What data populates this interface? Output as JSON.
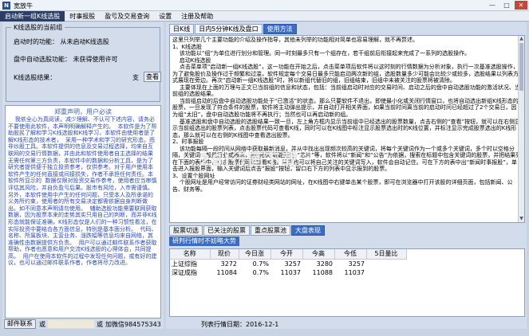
{
  "window": {
    "title": "宽放牛",
    "icon_letter": "N",
    "btn_min": "—",
    "btn_max": "□",
    "btn_close": "✕"
  },
  "menu": [
    "启动新一组K线选股",
    "时事报股",
    "盈亏及交易查询",
    "设置",
    "注册及帮助"
  ],
  "left": {
    "group_title": "K线选股的当前组",
    "line1": "启动时的功能：  从未启动K线选股",
    "line2": "盘中自动选股功能：  未获得使用许可",
    "line3": "K线选股结果：",
    "line3_tail": "支",
    "go_button": "查看",
    "notice_title": "郑重声明，用户必读",
    "notice_body": "    我依全心为真阅读，减少理解、不认可下述内容，请务必不要使用此软件，本声明明确解释产生的。  本软件是为了帮助股民了解和学习K线选股和K线学习，本软件由使用者是了解K线形态的技术者，  采用一种学术和学习的研究形态，而非炒股工具。本软件提供的信息及交易过程选择，均来自互联网的交易行情数据，并由此和软件使用者自主选择的结果无需任何第三方负责，本软件中的数据和分析工具，是为了研究者提供便于独立投资参考，仅供参考。对于用户使用本软件产生的任何直接或间接损失，作者不承担任何责任。本软件所显示的  数据仅限对投资交易作参考，使用者应当审慎评估其风险，并自负盈亏后果。股市有风险，入市需谨慎。  另外，本软件使用中产生的任何问题，只受本人及所承诺的义务所约束，使用者的所有交易决定都需依据自身判断做出。如不同意本声明请勿使用。  辅助选股功能需要联网获取数据，因为股票本来的走势其实只用自己的判断，而并非K线形态就能保证准确，K线形态仅是人们的一种习惯性看法，在实际投资中要结合各方面信息，特别是基本面分析。  代码、名称、所属板块、主营业务、涨跌幅等信息均来自网络，其准确性由数据提供方负责。  用户可以通过邮件联系作者获取帮助，作者也愿意和用户交流K线选股的心得体会，共同提高。  用户在使用本软件的过程中发现任何问题，或有好的建议，也可以通过邮件联系作者，作者将尽力改进。"
  },
  "left_status": {
    "mail_button": "邮件联系",
    "or1": "或",
    "or2": "或",
    "wechat": "加微信984575343"
  },
  "right": {
    "tabs": [
      {
        "label": "日K线",
        "selected": false
      },
      {
        "label": "日内5分钟K线及盘口",
        "selected": false
      },
      {
        "label": "使用方法",
        "selected": true
      }
    ],
    "doc_text": "这里只列举几个主要功能的介绍及操作指导，其他未列举的功能相对简单也容易理解，就不再赘述。\n1、K线选股\n    该功能以“组”为单位进行划分和管理。同一时刻最多只有一个组存在，若干组前后衔接起来完成了一系列的选股操作。\n    启动K线选股\n    点击菜单项“启动新一组K线选股”，这一功能在开始之后，点击菜单项后软件将以这时刻的行情数据为分析对象，执行一次基准选股操作，为了避免股价及操作过于频繁和过滥，软件规定每个交易日最多只能启动两次新的组，选股数量多少可能会比较少或较多，选股结果以列表方式展现在旁边。再次“启动新一组K线选股”时，将以新组代替旧的组，旧组结束，旧组中未被关注的股票将被清除。\n    主要体现在上面的万理与正文已当前组的信息和状态，包括：当前组启动时对应的交易时间、启动之后的盘中自动选股功能的激活状况、当前组的选股结果。\n    当前组启动的后盘中自动选股功能处于“已激活”的状态，那么只要软件不退出，即使最小化或关闭行情窗口，也将自动选出新组K线形态的股票，一旦发现了符合条件的股票，软件将主动弹出提示，并自动打开相关界面，如果当前时间离当前的启动时间已经超过了2个交易日，因为组“太旧”，盘中自动选股功能将不再执行；当然也可以再启动新的组。\n    基准选股和盘中自动选股的选股结果一致一旦，左上角方框内显示当前组中已经选出的股票数量，点击右侧的“查看”按钮，就可以在右侧显示当前组选出的股票列表，点击股票代码可查看K线，同时可以在K线图中标注显示股票选出时的K线位置，并标注显示完成股票选出的K线形态，那么就可以在右侧的K线图中查看选出股票。\n2、时事报股\n    该功能每隔一段时间从网络中获取最新消息，并从中找出出现频次较高的关键词，将每个关键词作为一个或多个关键词，多个时以空格分隔，关键词一般是行业或概念，如“光伏 新能源”、“芯片”等，软件将以“新闻”和“公告”为依据，搜索在标题中包含关键词的股票，并把结果列在下面的表格中，点击股票代码可查看K线。用户也可以将自己关注的关键词写入，软件会自动记住。可在下方的表中出“新闻时事报股”，单击进入报股界面，输入关键词后点击“报股”按钮，留口右下方的列表中显示报到的股票。\n3、设置个股网址\n    个股网址是用户经常访问的证券财经类网站的网址，在K线图中右键单击某个股票，即可在浏览器中打开该股的详细页面，包括新闻、公告、财务等。"
  },
  "lower": {
    "tabs": [
      {
        "label": "股票切选",
        "selected": false
      },
      {
        "label": "已关注的股票",
        "selected": false
      },
      {
        "label": "重点股票池",
        "selected": false
      },
      {
        "label": "大盘表现",
        "selected": true
      }
    ],
    "sub_header": "研判行情时不妨略大势",
    "columns": [
      "名称",
      "现价",
      "今日涨",
      "今开",
      "今高",
      "今低",
      "5日量比"
    ],
    "rows": [
      [
        "上证综指",
        "3272",
        "0.7%",
        "3257",
        "3280",
        "3257",
        ""
      ],
      [
        "深证成指",
        "11084",
        "0.7%",
        "11037",
        "11088",
        "11037",
        ""
      ]
    ]
  },
  "right_status": {
    "date_label": "列表行情日期：2016-12-1"
  },
  "watermark": "2SI行画下载"
}
